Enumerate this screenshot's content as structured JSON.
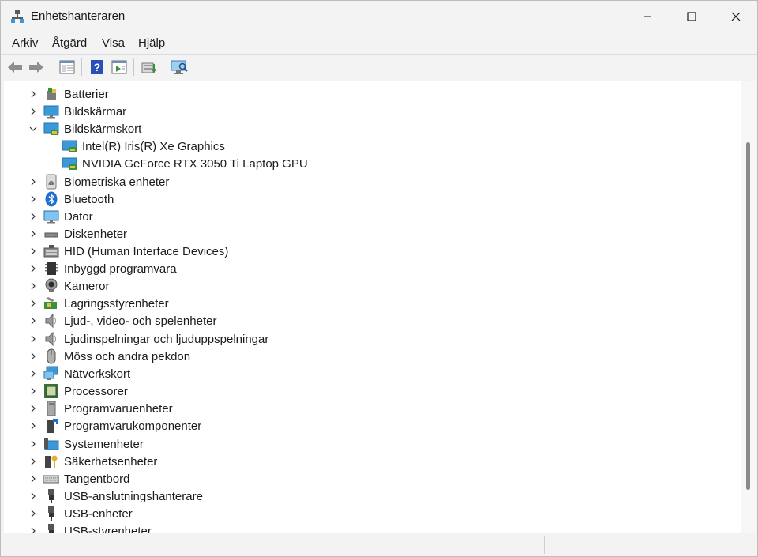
{
  "window": {
    "title": "Enhetshanteraren"
  },
  "menu": {
    "items": [
      "Arkiv",
      "Åtgärd",
      "Visa",
      "Hjälp"
    ]
  },
  "toolbar": {
    "buttons": [
      "back-icon",
      "forward-icon",
      "show-hide-console-tree-icon",
      "help-icon",
      "properties-icon",
      "update-driver-icon",
      "scan-hardware-icon"
    ]
  },
  "tree": {
    "batterier": "Batterier",
    "bildskarmar": "Bildskärmar",
    "bildskarmskort": "Bildskärmskort",
    "intel_gpu": "Intel(R) Iris(R) Xe Graphics",
    "nvidia_gpu": "NVIDIA GeForce RTX 3050 Ti Laptop GPU",
    "biometriska": "Biometriska enheter",
    "bluetooth": "Bluetooth",
    "dator": "Dator",
    "disk": "Diskenheter",
    "hid": "HID (Human Interface Devices)",
    "inbyggd": "Inbyggd programvara",
    "kameror": "Kameror",
    "lagring": "Lagringsstyrenheter",
    "ljud": "Ljud-, video- och spelenheter",
    "ljudinsp": "Ljudinspelningar och ljuduppspelningar",
    "moss": "Möss och andra pekdon",
    "natverk": "Nätverkskort",
    "processorer": "Processorer",
    "programvaruenheter": "Programvaruenheter",
    "programvarukomp": "Programvarukomponenter",
    "system": "Systemenheter",
    "sakerhet": "Säkerhetsenheter",
    "tangentbord": "Tangentbord",
    "usb_anslut": "USB-anslutningshanterare",
    "usb_enheter": "USB-enheter",
    "usb_styr": "USB-styrenheter"
  },
  "colors": {
    "accent": "#0078d4",
    "monitor_blue": "#3a9ad9",
    "chip_green": "#3c8f3c"
  }
}
